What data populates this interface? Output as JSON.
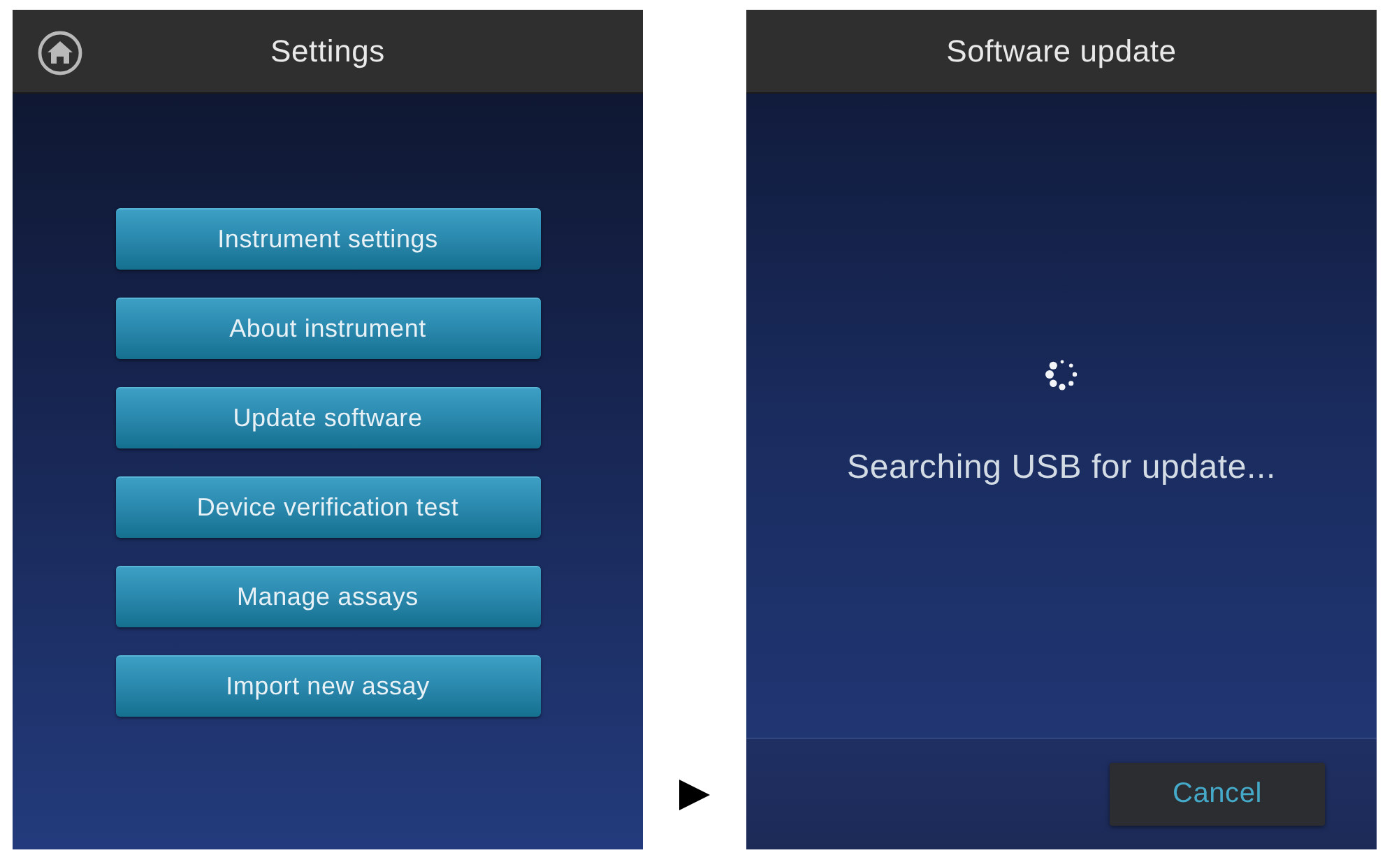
{
  "settings_screen": {
    "title": "Settings",
    "menu_buttons": [
      "Instrument settings",
      "About instrument",
      "Update software",
      "Device verification test",
      "Manage assays",
      "Import new assay"
    ]
  },
  "update_screen": {
    "title": "Software update",
    "status_message": "Searching USB for update...",
    "cancel_button": "Cancel"
  }
}
